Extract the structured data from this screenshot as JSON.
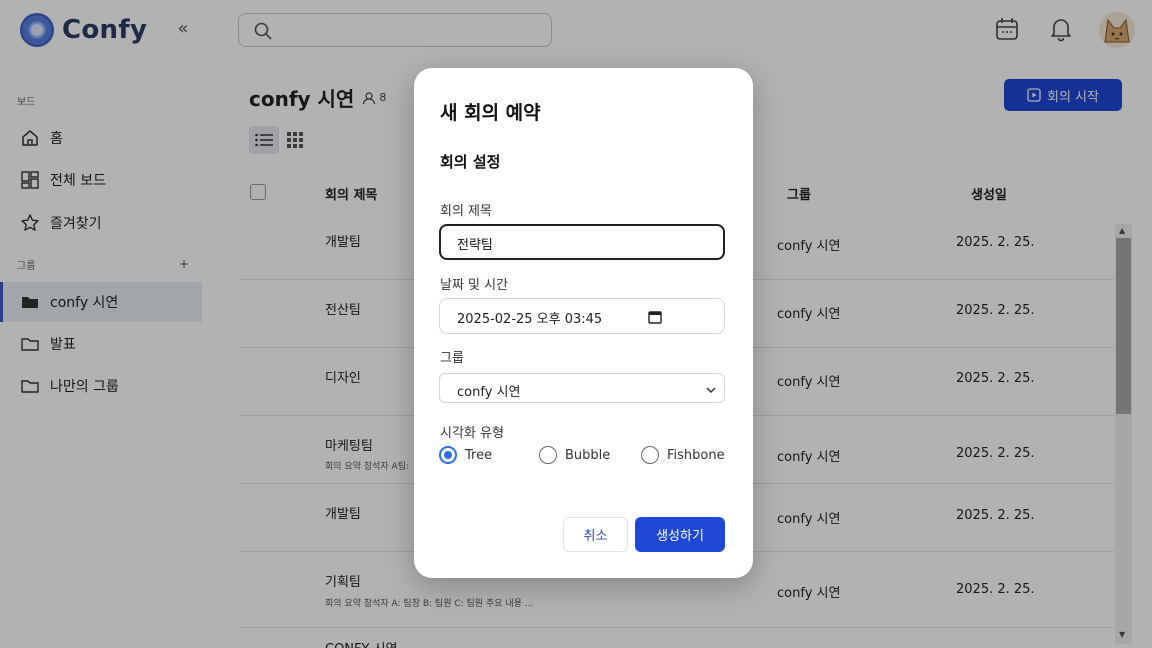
{
  "app": {
    "logo_text": "Confy"
  },
  "header": {
    "search_placeholder": "",
    "icons": [
      "calendar-icon",
      "bell-icon",
      "avatar"
    ]
  },
  "sidebar": {
    "section_board": "보드",
    "section_group": "그룹",
    "group_add": "+",
    "items": [
      {
        "label": "홈",
        "icon": "home-icon"
      },
      {
        "label": "전체 보드",
        "icon": "grid-board-icon"
      },
      {
        "label": "즐겨찾기",
        "icon": "star-icon"
      }
    ],
    "groups": [
      {
        "label": "confy 시연",
        "icon": "folder-filled-icon",
        "active": true
      },
      {
        "label": "발표",
        "icon": "folder-icon"
      },
      {
        "label": "나만의 그룹",
        "icon": "folder-icon"
      }
    ]
  },
  "main": {
    "title": "confy 시연",
    "member_count": "8",
    "start_button": "회의 시작",
    "table": {
      "headers": {
        "title": "회의 제목",
        "group": "그룹",
        "created": "생성일"
      },
      "rows": [
        {
          "name": "개발팀",
          "summary": "",
          "group": "confy 시연",
          "date": "2025. 2. 25."
        },
        {
          "name": "전산팀",
          "summary": "",
          "group": "confy 시연",
          "date": "2025. 2. 25."
        },
        {
          "name": "디자인",
          "summary": "",
          "group": "confy 시연",
          "date": "2025. 2. 25."
        },
        {
          "name": "마케팅팀",
          "summary": "회의 요약 참석자 A팀:",
          "group": "confy 시연",
          "date": "2025. 2. 25."
        },
        {
          "name": "개발팀",
          "summary": "",
          "group": "confy 시연",
          "date": "2025. 2. 25."
        },
        {
          "name": "기획팀",
          "summary": "회의 요약 참석자 A: 팀장 B: 팀원 C: 팀원 주요 내용 ...",
          "group": "confy 시연",
          "date": "2025. 2. 25."
        },
        {
          "name": "CONFY 시연",
          "summary": "",
          "group": "",
          "date": ""
        }
      ]
    }
  },
  "modal": {
    "title": "새 회의 예약",
    "section": "회의 설정",
    "title_label": "회의 제목",
    "title_value": "전략팀",
    "datetime_label": "날짜 및 시간",
    "datetime_value": "2025-02-25 오후 03:45",
    "group_label": "그룹",
    "group_value": "confy 시연",
    "viz_label": "시각화 유형",
    "viz_options": [
      "Tree",
      "Bubble",
      "Fishbone"
    ],
    "viz_selected": "Tree",
    "cancel": "취소",
    "create": "생성하기"
  },
  "colors": {
    "primary": "#1f47d6",
    "radio": "#2f6ee0",
    "overlay": "rgba(0,0,0,0.30)"
  }
}
